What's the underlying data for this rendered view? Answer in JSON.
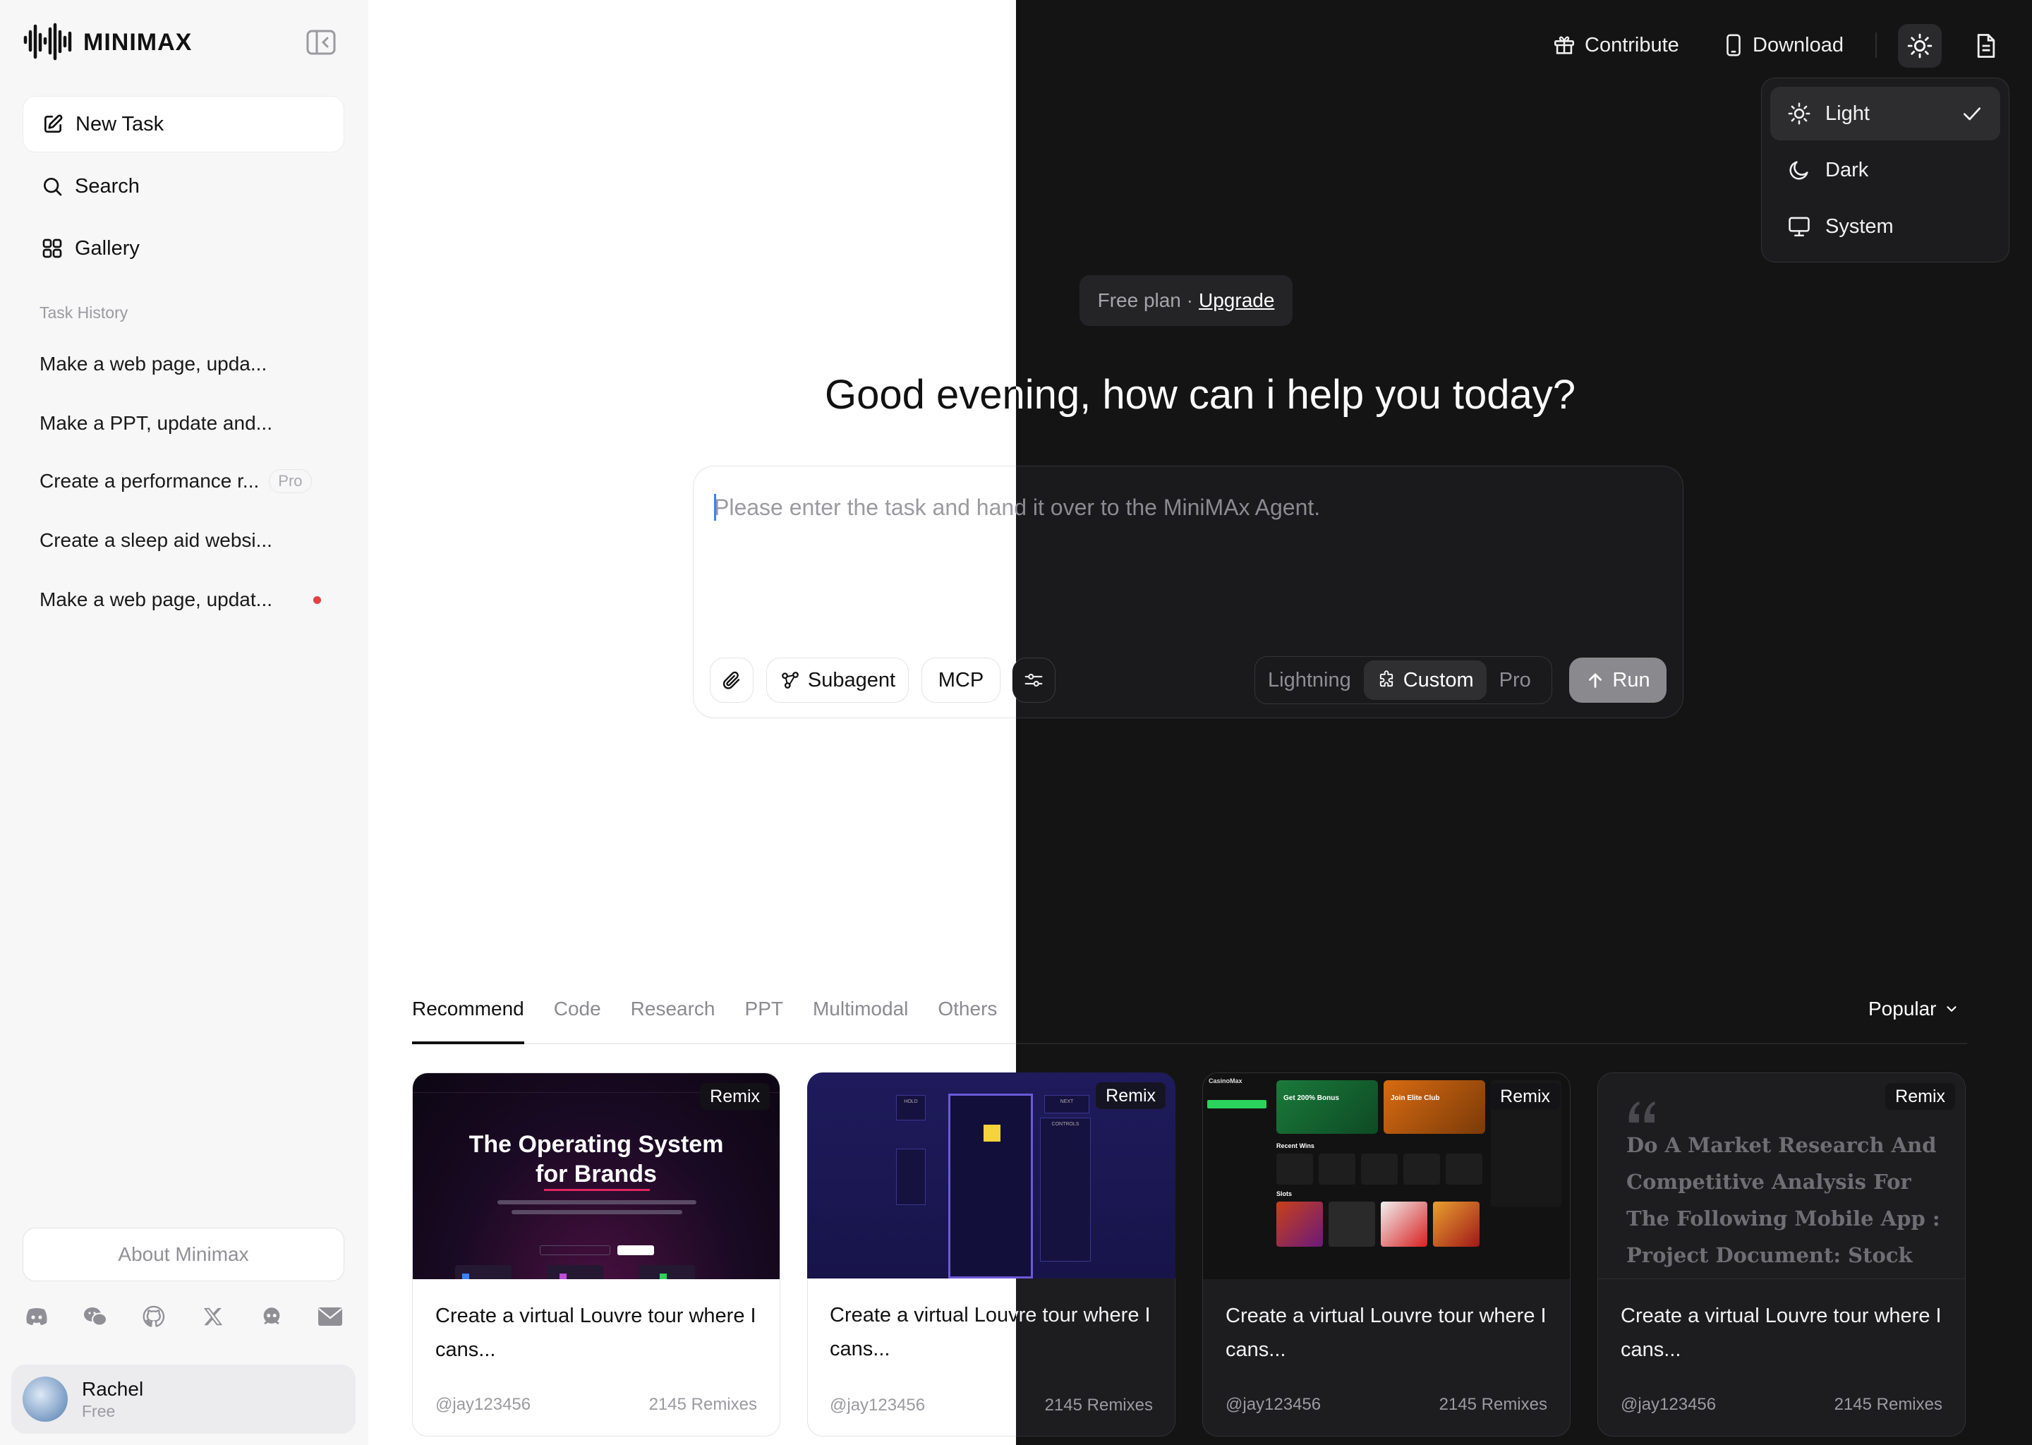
{
  "brand": {
    "name": "MINIMAX"
  },
  "sidebar": {
    "new_task": "New Task",
    "search": "Search",
    "gallery": "Gallery",
    "history_label": "Task History",
    "history": [
      {
        "label": "Make a web page, upda..."
      },
      {
        "label": "Make a PPT, update and..."
      },
      {
        "label": "Create a performance r...",
        "badge": "Pro"
      },
      {
        "label": "Create a sleep aid websi..."
      },
      {
        "label": "Make a web page, updat..."
      }
    ],
    "about": "About Minimax",
    "user": {
      "name": "Rachel",
      "plan": "Free"
    }
  },
  "header": {
    "contribute": "Contribute",
    "download": "Download"
  },
  "theme_menu": {
    "items": [
      {
        "label": "Light",
        "icon": "sun-icon",
        "selected": true
      },
      {
        "label": "Dark",
        "icon": "moon-icon"
      },
      {
        "label": "System",
        "icon": "monitor-icon"
      }
    ]
  },
  "plan_banner": {
    "text": "Free plan · ",
    "upgrade": "Upgrade"
  },
  "greeting": "Good evening, how can i help you today?",
  "composer": {
    "placeholder": "Please enter the task and hand it over to the MiniMAx Agent.",
    "subagent": "Subagent",
    "mcp": "MCP",
    "modes": {
      "lightning": "Lightning",
      "custom": "Custom",
      "pro": "Pro"
    },
    "run": "Run"
  },
  "categories": {
    "tabs": [
      "Recommend",
      "Code",
      "Research",
      "PPT",
      "Multimodal",
      "Others"
    ],
    "sort": "Popular"
  },
  "cards": [
    {
      "remix": "Remix",
      "thumb": {
        "headline_1": "The Operating System",
        "headline_2": "for Brands"
      },
      "title": "Create a virtual Louvre tour where I cans...",
      "author": "@jay123456",
      "remixes": "2145 Remixes"
    },
    {
      "remix": "Remix",
      "thumb": {
        "left_label": "HOLD",
        "right_label": "NEXT",
        "controls_label": "CONTROLS"
      },
      "title": "Create a virtual Louvre tour where I cans...",
      "author": "@jay123456",
      "remixes": "2145 Remixes"
    },
    {
      "remix": "Remix",
      "thumb": {
        "brand": "CasinoMax",
        "promo_1": "Get 200% Bonus",
        "promo_2": "Join Elite Club",
        "section_1": "Recent Wins",
        "section_2": "Slots"
      },
      "title": "Create a virtual Louvre tour where I cans...",
      "author": "@jay123456",
      "remixes": "2145 Remixes"
    },
    {
      "remix": "Remix",
      "thumb": {
        "quote": "Do A Market Research And Competitive Analysis For The Following Mobile App : Project Document: Stock Market Res..."
      },
      "title": "Create a virtual Louvre tour where I cans...",
      "author": "@jay123456",
      "remixes": "2145 Remixes"
    }
  ],
  "colors": {
    "sidebar_bg": "#f7f7f8",
    "dark_bg": "#141414",
    "card1_bg": "#1a0a24",
    "card2_bg": "#1f1b5c",
    "card3_bg": "#121212",
    "accent_green": "#2bd35c",
    "accent_orange": "#d86b12"
  }
}
